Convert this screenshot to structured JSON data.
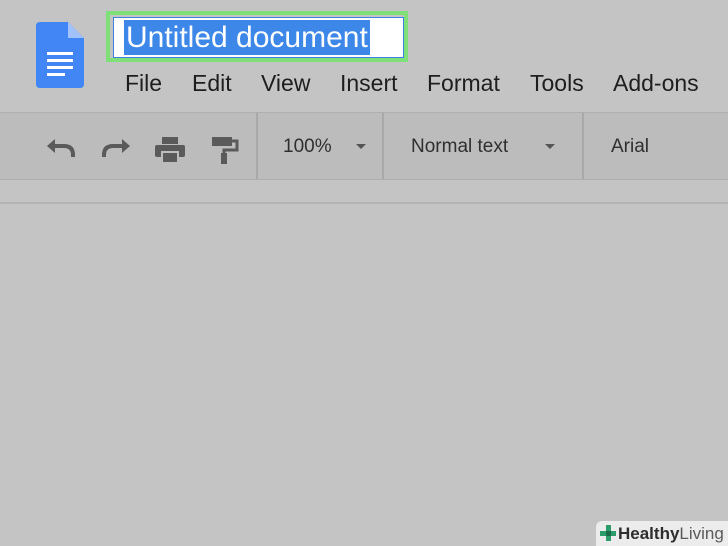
{
  "document": {
    "title": "Untitled document"
  },
  "menu": {
    "items": [
      "File",
      "Edit",
      "View",
      "Insert",
      "Format",
      "Tools",
      "Add-ons"
    ]
  },
  "toolbar": {
    "zoom": "100%",
    "style": "Normal text",
    "font": "Arial",
    "icons": [
      "undo-icon",
      "redo-icon",
      "print-icon",
      "paint-format-icon"
    ]
  },
  "watermark": {
    "brand_bold": "Healthy",
    "brand_light": "Living"
  },
  "colors": {
    "docs_blue": "#4285f4",
    "selection": "#3c87e8",
    "highlight_outline": "#7fe07a",
    "background": "#c4c4c4"
  }
}
